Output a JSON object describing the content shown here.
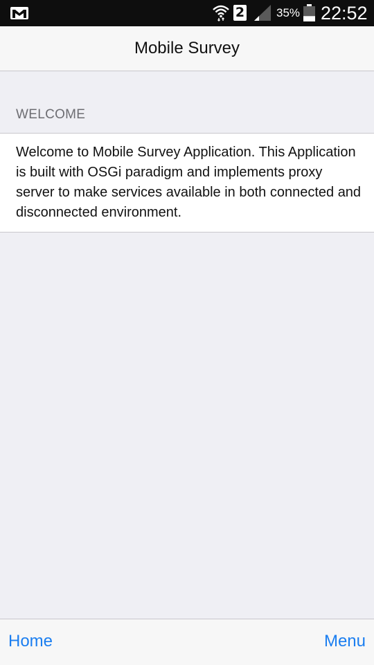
{
  "status_bar": {
    "notification_icon": "gmail-icon",
    "sim_slot": "2",
    "battery_percent": "35%",
    "battery_level": 0.35,
    "time": "22:52"
  },
  "nav": {
    "title": "Mobile Survey"
  },
  "section": {
    "header": "WELCOME",
    "body": "Welcome to Mobile Survey Application. This Application is built with OSGi paradigm and implements proxy server to make services available in both connected and disconnected environment."
  },
  "tab_bar": {
    "home_label": "Home",
    "menu_label": "Menu"
  },
  "colors": {
    "accent": "#1b7ef0",
    "background": "#efeff4",
    "status_bar": "#0e0e0e"
  }
}
